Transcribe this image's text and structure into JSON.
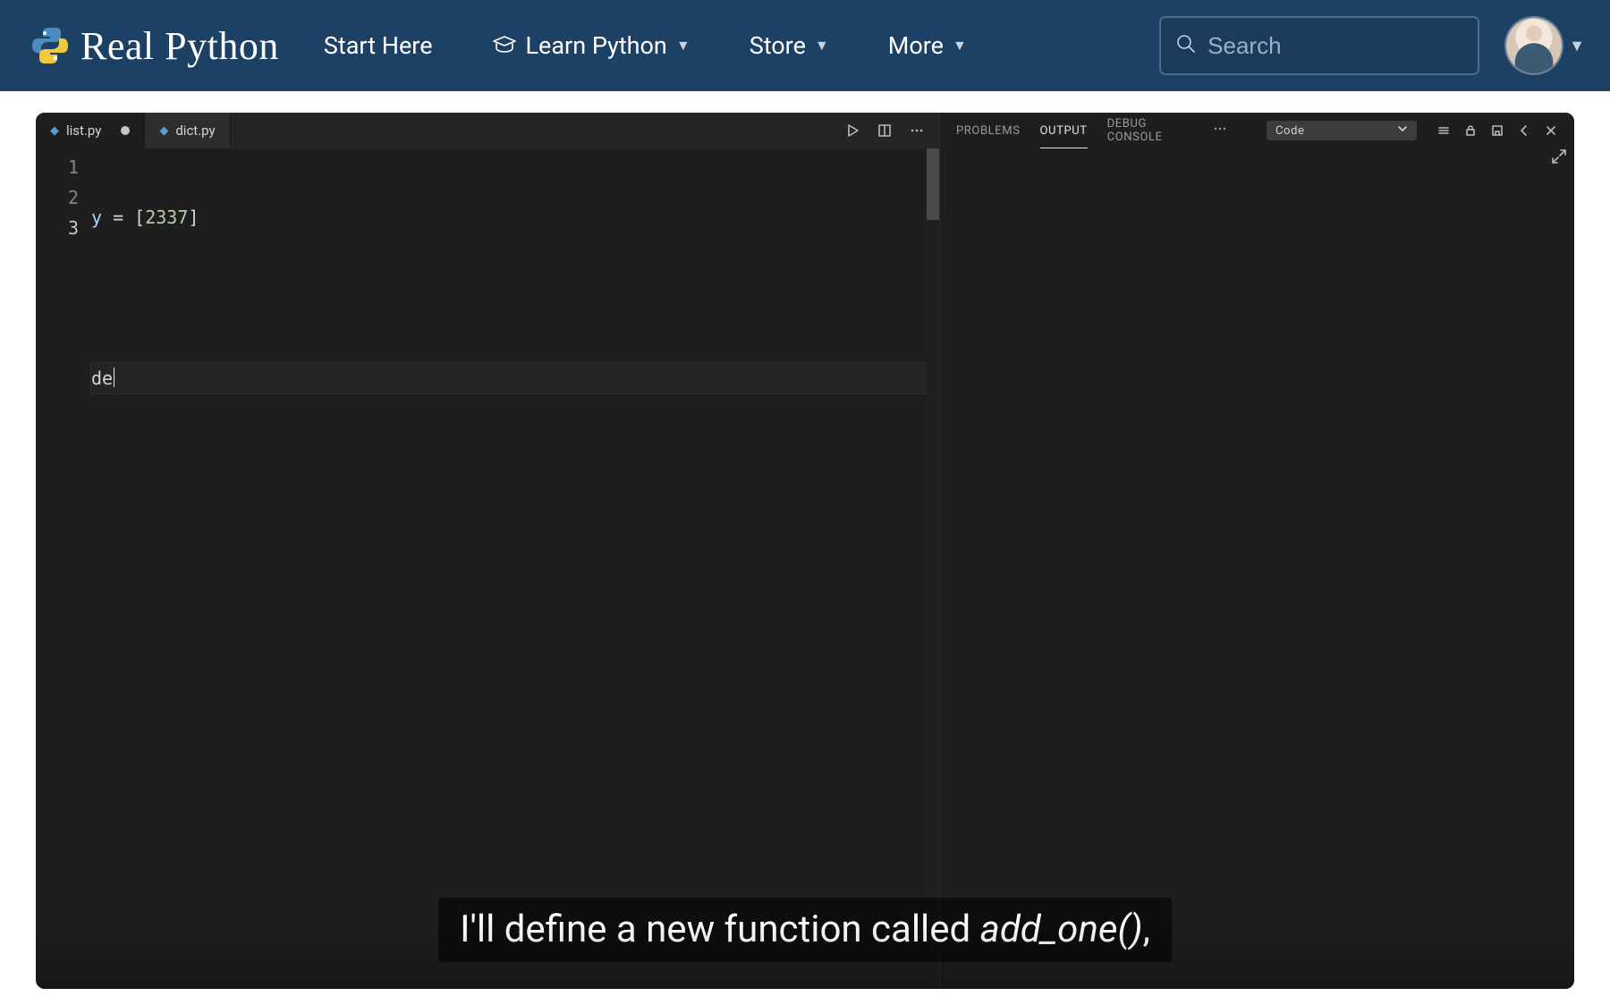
{
  "nav": {
    "brand_text": "Real Python",
    "links": {
      "start": "Start Here",
      "learn": "Learn Python",
      "store": "Store",
      "more": "More"
    },
    "search_placeholder": "Search"
  },
  "editor": {
    "tabs": [
      {
        "filename": "list.py",
        "active": true,
        "dirty": true
      },
      {
        "filename": "dict.py",
        "active": false,
        "dirty": false
      }
    ],
    "line_numbers": [
      "1",
      "2",
      "3"
    ],
    "current_line_index": 2,
    "code": {
      "line1": {
        "var": "y",
        "op": " = ",
        "open": "[",
        "num": "2337",
        "close": "]"
      },
      "line3_partial": "de"
    }
  },
  "panel": {
    "tabs": {
      "problems": "PROBLEMS",
      "output": "OUTPUT",
      "debug_console": "DEBUG CONSOLE"
    },
    "active_tab": "output",
    "output_filter_label": "Code"
  },
  "caption": {
    "prefix": "I'll define a new function called ",
    "function": "add_one()",
    "suffix": ","
  }
}
